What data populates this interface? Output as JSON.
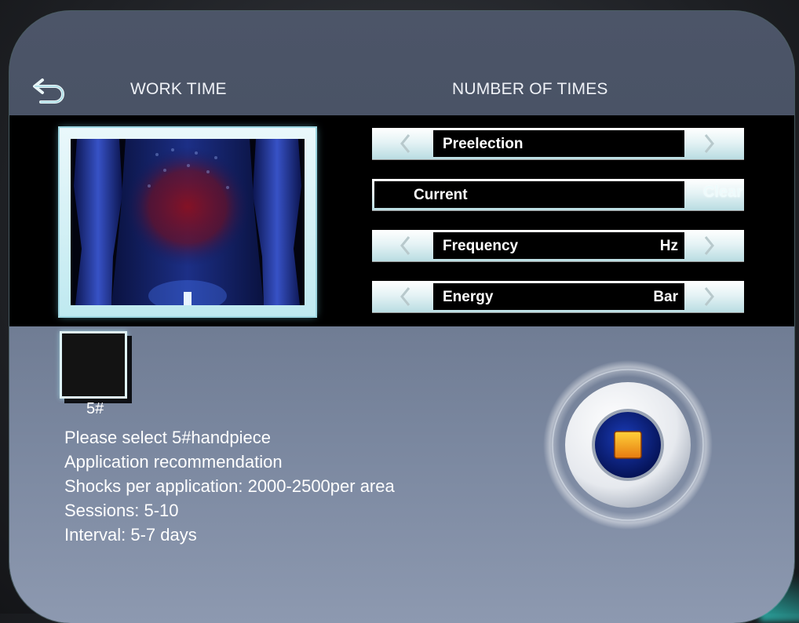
{
  "header": {
    "work_time": "WORK TIME",
    "number_of_times": "NUMBER OF TIMES"
  },
  "controls": {
    "preelection": {
      "label": "Preelection",
      "unit": ""
    },
    "current": {
      "label": "Current",
      "action": "Clear"
    },
    "frequency": {
      "label": "Frequency",
      "unit": "Hz"
    },
    "energy": {
      "label": "Energy",
      "unit": "Bar"
    }
  },
  "handpiece": {
    "label": "5#"
  },
  "info": {
    "line1": "Please select 5#handpiece",
    "line2": "Application recommendation",
    "line3": "Shocks per application: 2000-2500per area",
    "line4": "Sessions: 5-10",
    "line5": "Interval: 5-7 days"
  },
  "colors": {
    "accent_cyan": "#bfe9f0",
    "stop_square": "#f3a21e",
    "stop_ring": "#0b1f72"
  },
  "icons": {
    "back": "back-arrow-icon",
    "left": "chevron-left-icon",
    "right": "chevron-right-icon",
    "stop": "stop-icon"
  }
}
